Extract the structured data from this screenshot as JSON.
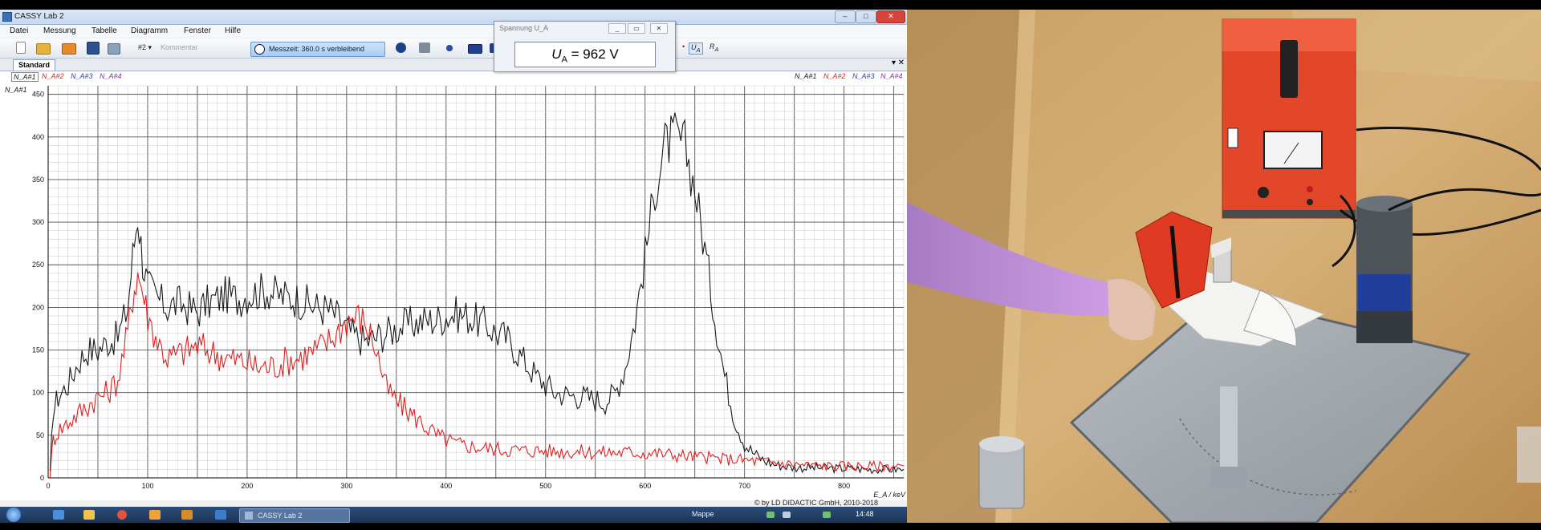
{
  "window": {
    "title": "CASSY Lab 2",
    "min_label": "–",
    "max_label": "□",
    "close_label": "✕"
  },
  "menu": [
    "Datei",
    "Messung",
    "Tabelle",
    "Diagramm",
    "Fenster",
    "Hilfe"
  ],
  "toolbar": {
    "experiment_combo": "#2 ▾",
    "comment_placeholder": "Kommentar",
    "measure_button": "Messzeit: 360.0 s verbleibend"
  },
  "tab": {
    "label": "Standard",
    "pin": "▾",
    "close": "✕"
  },
  "legend_left": [
    "N_A#1",
    "N_A#2",
    "N_A#3",
    "N_A#4"
  ],
  "legend_right": [
    "N_A#1",
    "N_A#2",
    "N_A#3",
    "N_A#4"
  ],
  "popup": {
    "title": "Spannung U_A",
    "readout_text": "U",
    "readout_sub": "A",
    "readout_value": "= 962 V"
  },
  "copyright": "© by LD DIDACTIC GmbH, 2010-2018",
  "taskbar": {
    "task_label": "CASSY Lab 2",
    "tray_label": "Mappe",
    "clock": "14:48"
  },
  "colors": {
    "series1": "#1a1a1a",
    "series2": "#e02020",
    "series3": "#2a3fbf",
    "series4": "#8b2fa0"
  },
  "chart_data": {
    "type": "line",
    "ylabel": "N_A#1",
    "xlabel": "E_A / keV",
    "xlim": [
      0,
      860
    ],
    "ylim": [
      0,
      460
    ],
    "xticks": [
      0,
      100,
      200,
      300,
      400,
      500,
      600,
      700,
      800
    ],
    "yticks": [
      0,
      50,
      100,
      150,
      200,
      250,
      300,
      350,
      400,
      450
    ],
    "grid": true,
    "series": [
      {
        "name": "N_A#1",
        "color": "#1a1a1a",
        "x": [
          2,
          5,
          10,
          20,
          30,
          40,
          50,
          60,
          70,
          80,
          85,
          90,
          95,
          100,
          110,
          120,
          130,
          140,
          150,
          160,
          170,
          180,
          190,
          200,
          210,
          220,
          230,
          240,
          250,
          260,
          270,
          280,
          290,
          300,
          310,
          320,
          330,
          340,
          350,
          360,
          370,
          380,
          390,
          400,
          410,
          420,
          430,
          440,
          450,
          460,
          470,
          480,
          490,
          500,
          510,
          520,
          530,
          540,
          550,
          560,
          570,
          580,
          590,
          600,
          610,
          620,
          630,
          640,
          650,
          660,
          670,
          680,
          690,
          700,
          710,
          720,
          730,
          740,
          750,
          760,
          770,
          780,
          790,
          800,
          810,
          820,
          830,
          840,
          850,
          860
        ],
        "y": [
          5,
          80,
          95,
          110,
          135,
          150,
          150,
          160,
          165,
          200,
          260,
          310,
          255,
          225,
          210,
          200,
          205,
          200,
          195,
          205,
          210,
          215,
          210,
          215,
          218,
          220,
          215,
          212,
          210,
          205,
          200,
          198,
          190,
          175,
          165,
          160,
          165,
          170,
          175,
          180,
          182,
          185,
          185,
          190,
          192,
          190,
          185,
          180,
          170,
          165,
          150,
          135,
          120,
          110,
          100,
          98,
          96,
          95,
          92,
          90,
          100,
          130,
          185,
          260,
          340,
          390,
          400,
          390,
          340,
          270,
          190,
          120,
          70,
          40,
          28,
          20,
          16,
          14,
          12,
          12,
          12,
          12,
          11,
          11,
          11,
          10,
          10,
          10,
          10,
          10
        ]
      },
      {
        "name": "N_A#2",
        "color": "#e02020",
        "x": [
          2,
          5,
          10,
          20,
          30,
          40,
          50,
          60,
          70,
          80,
          85,
          90,
          95,
          100,
          110,
          120,
          130,
          140,
          150,
          160,
          170,
          180,
          190,
          200,
          210,
          220,
          230,
          240,
          250,
          260,
          270,
          280,
          290,
          300,
          310,
          320,
          330,
          340,
          350,
          360,
          370,
          380,
          390,
          400,
          410,
          420,
          430,
          440,
          450,
          460,
          470,
          480,
          490,
          500,
          510,
          520,
          530,
          540,
          550,
          560,
          570,
          580,
          590,
          600,
          610,
          620,
          630,
          640,
          650,
          660,
          670,
          680,
          690,
          700,
          710,
          720,
          730,
          740,
          750,
          760,
          770,
          780,
          790,
          800,
          810,
          820,
          830,
          840,
          850,
          860
        ],
        "y": [
          3,
          45,
          55,
          65,
          75,
          85,
          95,
          100,
          115,
          170,
          215,
          240,
          220,
          190,
          160,
          140,
          145,
          150,
          155,
          150,
          145,
          140,
          138,
          135,
          130,
          130,
          132,
          138,
          140,
          145,
          150,
          158,
          170,
          185,
          190,
          180,
          150,
          105,
          90,
          80,
          70,
          60,
          50,
          45,
          40,
          38,
          36,
          35,
          34,
          33,
          33,
          32,
          32,
          32,
          31,
          31,
          31,
          30,
          30,
          30,
          30,
          30,
          30,
          29,
          29,
          28,
          27,
          26,
          25,
          24,
          23,
          22,
          22,
          21,
          20,
          19,
          18,
          17,
          16,
          15,
          15,
          14,
          14,
          14,
          14,
          14,
          14,
          14,
          14,
          14
        ]
      }
    ]
  }
}
